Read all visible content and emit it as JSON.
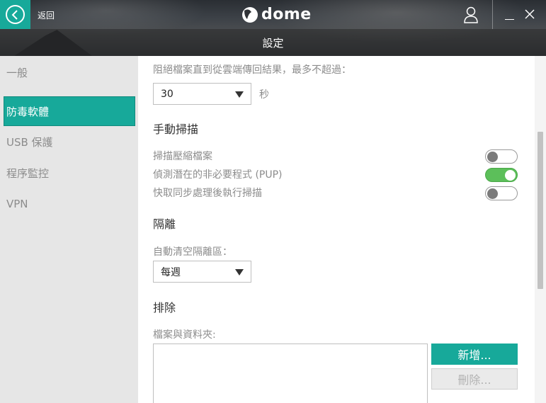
{
  "header": {
    "back_label": "返回",
    "logo_text": "dome",
    "title": "設定"
  },
  "sidebar": {
    "items": [
      {
        "label": "一般",
        "active": false
      },
      {
        "label": "防毒軟體",
        "active": true
      },
      {
        "label": "USB 保護",
        "active": false
      },
      {
        "label": "程序監控",
        "active": false
      },
      {
        "label": "VPN",
        "active": false
      }
    ]
  },
  "content": {
    "block_label": "阻絕檔案直到從雲端傳回結果，最多不超過：",
    "block_select_value": "30",
    "block_unit": "秒",
    "manual_scan_title": "手動掃描",
    "toggles": [
      {
        "label": "掃描壓縮檔案",
        "on": false
      },
      {
        "label": "偵測潛在的非必要程式 (PUP)",
        "on": true
      },
      {
        "label": "快取同步處理後執行掃描",
        "on": false
      }
    ],
    "quarantine_title": "隔離",
    "auto_clean_label": "自動清空隔離區：",
    "auto_clean_value": "每週",
    "exclusions_title": "排除",
    "files_label": "檔案與資料夾:",
    "add_button": "新增...",
    "delete_button": "刪除..."
  },
  "colors": {
    "accent": "#17a99a",
    "toggle_on": "#5cbf5a",
    "sidebar_bg": "#e6e6e6"
  }
}
